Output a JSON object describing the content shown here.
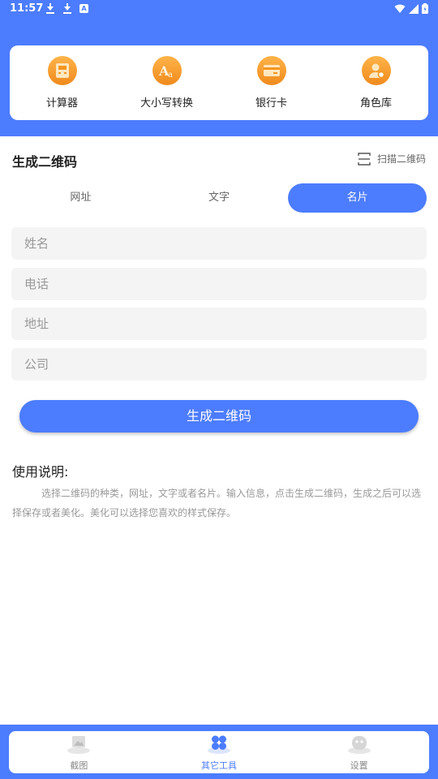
{
  "status_bar": {
    "time": "11:57"
  },
  "tools": [
    {
      "label": "计算器",
      "icon": "calculator-icon"
    },
    {
      "label": "大小写转换",
      "icon": "case-convert-icon"
    },
    {
      "label": "银行卡",
      "icon": "bank-card-icon"
    },
    {
      "label": "角色库",
      "icon": "role-library-icon"
    }
  ],
  "section": {
    "title": "生成二维码",
    "scan_label": "扫描二维码"
  },
  "tabs": [
    {
      "label": "网址"
    },
    {
      "label": "文字"
    },
    {
      "label": "名片",
      "active": true
    }
  ],
  "form": {
    "name_placeholder": "姓名",
    "phone_placeholder": "电话",
    "address_placeholder": "地址",
    "company_placeholder": "公司",
    "submit_label": "生成二维码"
  },
  "usage": {
    "title": "使用说明:",
    "text": "选择二维码的种类，网址，文字或者名片。输入信息，点击生成二维码，生成之后可以选择保存或者美化。美化可以选择您喜欢的样式保存。"
  },
  "bottom_nav": [
    {
      "label": "截图",
      "icon": "screenshot-icon"
    },
    {
      "label": "其它工具",
      "icon": "other-tools-icon",
      "active": true
    },
    {
      "label": "设置",
      "icon": "settings-icon"
    }
  ],
  "colors": {
    "accent": "#4c7cff",
    "tool_icon": "#f5961f",
    "field_bg": "#f4f4f4"
  }
}
